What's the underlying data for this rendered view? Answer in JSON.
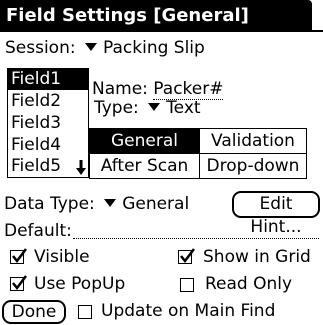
{
  "title": "Field Settings [General]",
  "session": {
    "label": "Session:",
    "value": "Packing Slip"
  },
  "fields": [
    "Field1",
    "Field2",
    "Field3",
    "Field4",
    "Field5"
  ],
  "name": {
    "label": "Name:",
    "value": "Packer#"
  },
  "type": {
    "label": "Type:",
    "value": "Text"
  },
  "tabs": [
    "General",
    "Validation",
    "After Scan",
    "Drop-down"
  ],
  "data_type": {
    "label": "Data Type:",
    "value": "General"
  },
  "edit_hint_label": "Edit Hint...",
  "default_label": "Default:",
  "options": {
    "visible": {
      "label": "Visible",
      "checked": true
    },
    "show_in_grid": {
      "label": "Show in Grid",
      "checked": true
    },
    "use_popup": {
      "label": "Use PopUp",
      "checked": true
    },
    "read_only": {
      "label": "Read Only",
      "checked": false
    },
    "update_on_main_find": {
      "label": "Update on Main Find",
      "checked": false
    }
  },
  "done_label": "Done"
}
